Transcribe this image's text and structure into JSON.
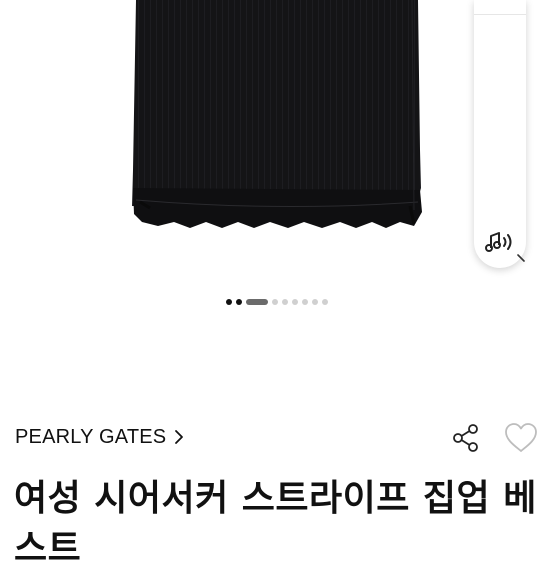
{
  "product": {
    "brand": "PEARLY GATES",
    "title": "여성 시어서커 스트라이프 집업 베스트"
  },
  "gallery": {
    "dot_count": 9,
    "dot_style": [
      "dark",
      "dark",
      "active",
      "light",
      "light",
      "light",
      "light",
      "light",
      "light"
    ]
  },
  "icons": {
    "audio": "audio-speaker-icon",
    "share": "share-icon",
    "favorite": "heart-outline-icon",
    "brand_link": "chevron-right-icon",
    "peek": "chevron-icon"
  },
  "colors": {
    "garment": "#141416",
    "text": "#111111",
    "dot_inactive": "#d0d0d0",
    "dot_active": "#6b6b6b"
  }
}
